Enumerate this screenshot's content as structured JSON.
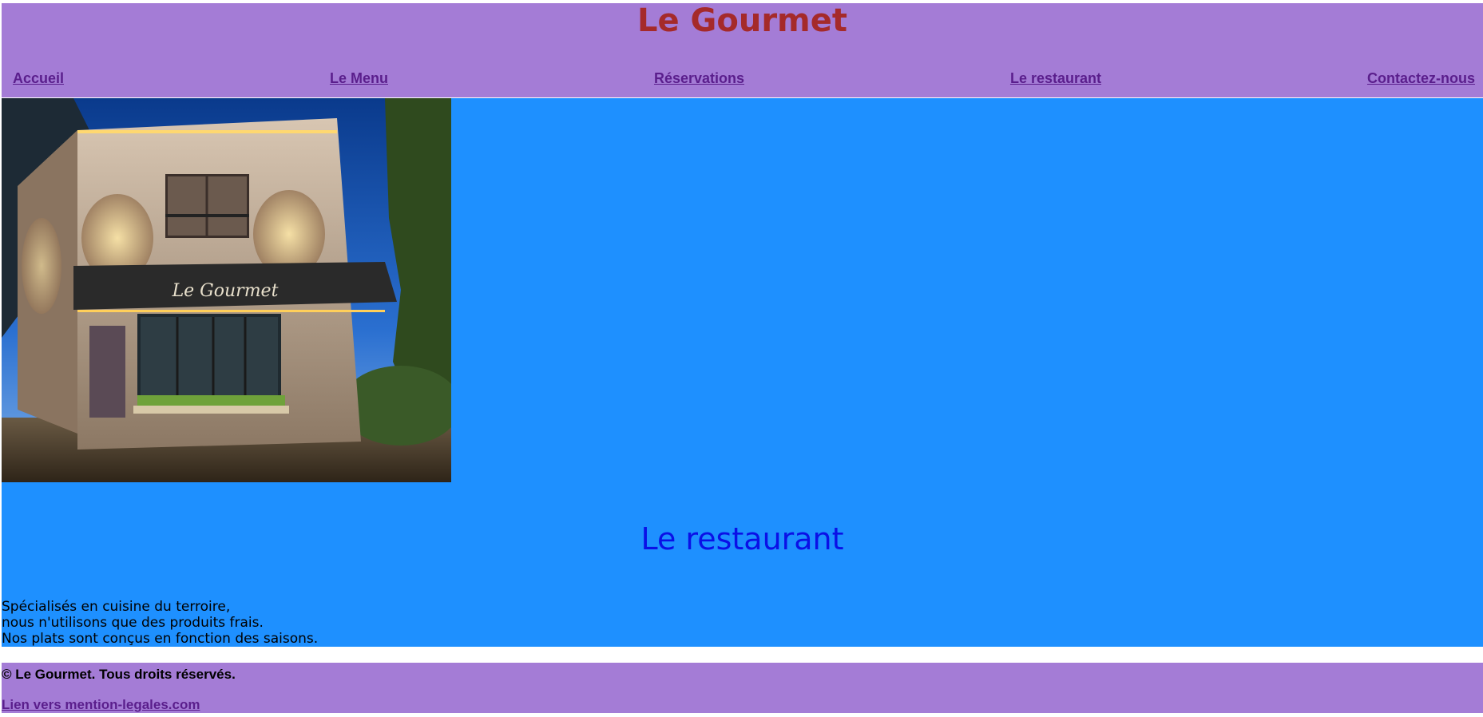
{
  "header": {
    "title": "Le Gourmet",
    "nav": [
      {
        "label": "Accueil"
      },
      {
        "label": "Le Menu"
      },
      {
        "label": "Réservations"
      },
      {
        "label": "Le restaurant"
      },
      {
        "label": "Contactez-nous"
      }
    ]
  },
  "main": {
    "photo": {
      "sign_text": "Le Gourmet"
    },
    "section_title": "Le restaurant",
    "description_lines": [
      "Spécialisés en cuisine du terroire,",
      "nous n'utilisons que des produits frais.",
      "Nos plats sont conçus en fonction des saisons."
    ]
  },
  "footer": {
    "copyright": "© Le Gourmet. Tous droits réservés.",
    "legal_link": "Lien vers mention-legales.com"
  },
  "colors": {
    "header_footer_bg": "#a47cd6",
    "main_bg": "#1e90ff",
    "title": "#a52a2a",
    "nav_link": "#5a1e8c",
    "section_title": "#0b10e6"
  }
}
